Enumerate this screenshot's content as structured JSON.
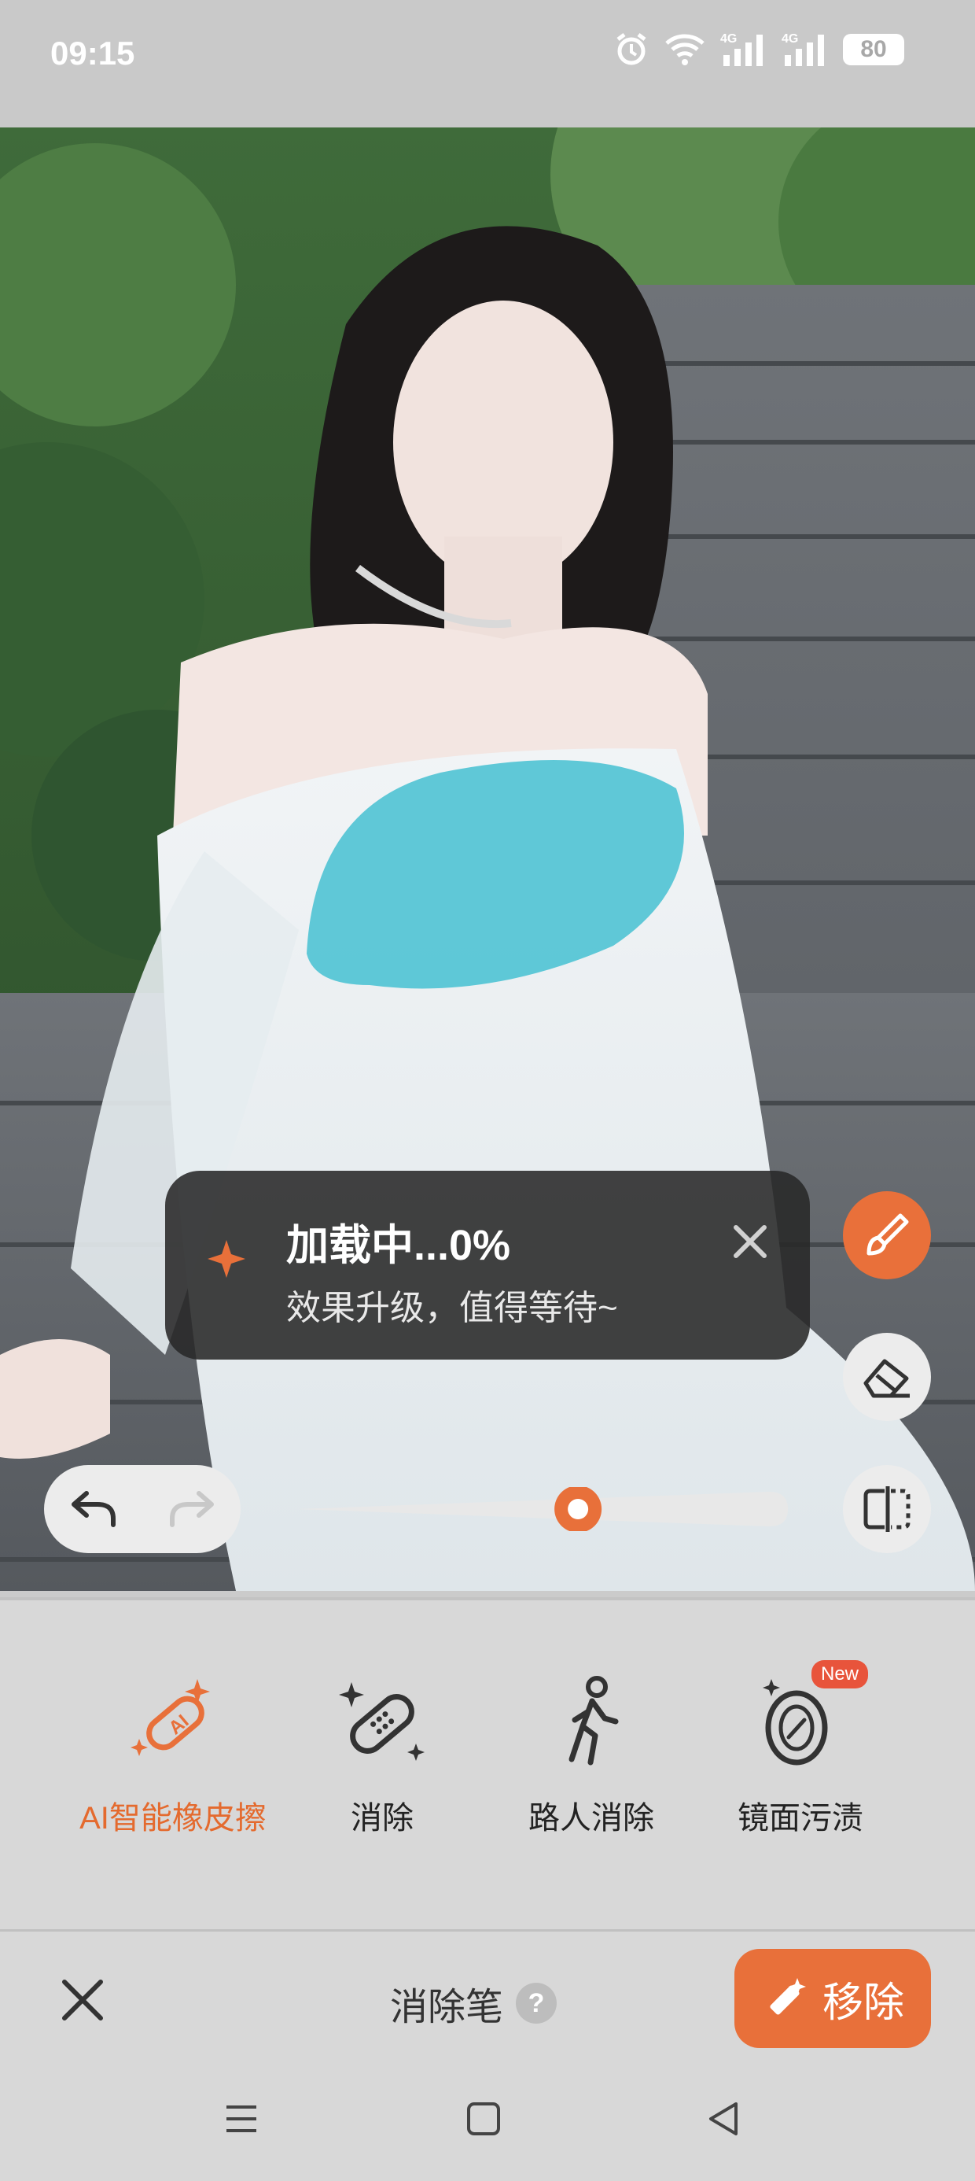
{
  "status_bar": {
    "time": "09:15",
    "battery": "80",
    "icons": [
      "alarm-icon",
      "wifi-icon",
      "signal-4g-icon",
      "signal-4g-icon",
      "battery-icon"
    ]
  },
  "toast": {
    "title": "加载中...0%",
    "subtitle": "效果升级，值得等待~",
    "icon": "sparkle-icon"
  },
  "side_tools": [
    "brush-icon",
    "eraser-icon",
    "compare-icon"
  ],
  "brush_size": {
    "value": 0.58
  },
  "tools": [
    {
      "label": "AI智能橡皮擦",
      "icon": "ai-eraser-icon",
      "active": true
    },
    {
      "label": "消除",
      "icon": "bandage-icon",
      "active": false
    },
    {
      "label": "路人消除",
      "icon": "pedestrian-icon",
      "active": false
    },
    {
      "label": "镜面污渍",
      "icon": "mirror-stain-icon",
      "active": false,
      "badge": "New"
    }
  ],
  "bottom_bar": {
    "title": "消除笔",
    "help": "?",
    "remove_button": "移除"
  },
  "colors": {
    "accent": "#e8703a",
    "mask": "#4fc3d4"
  }
}
